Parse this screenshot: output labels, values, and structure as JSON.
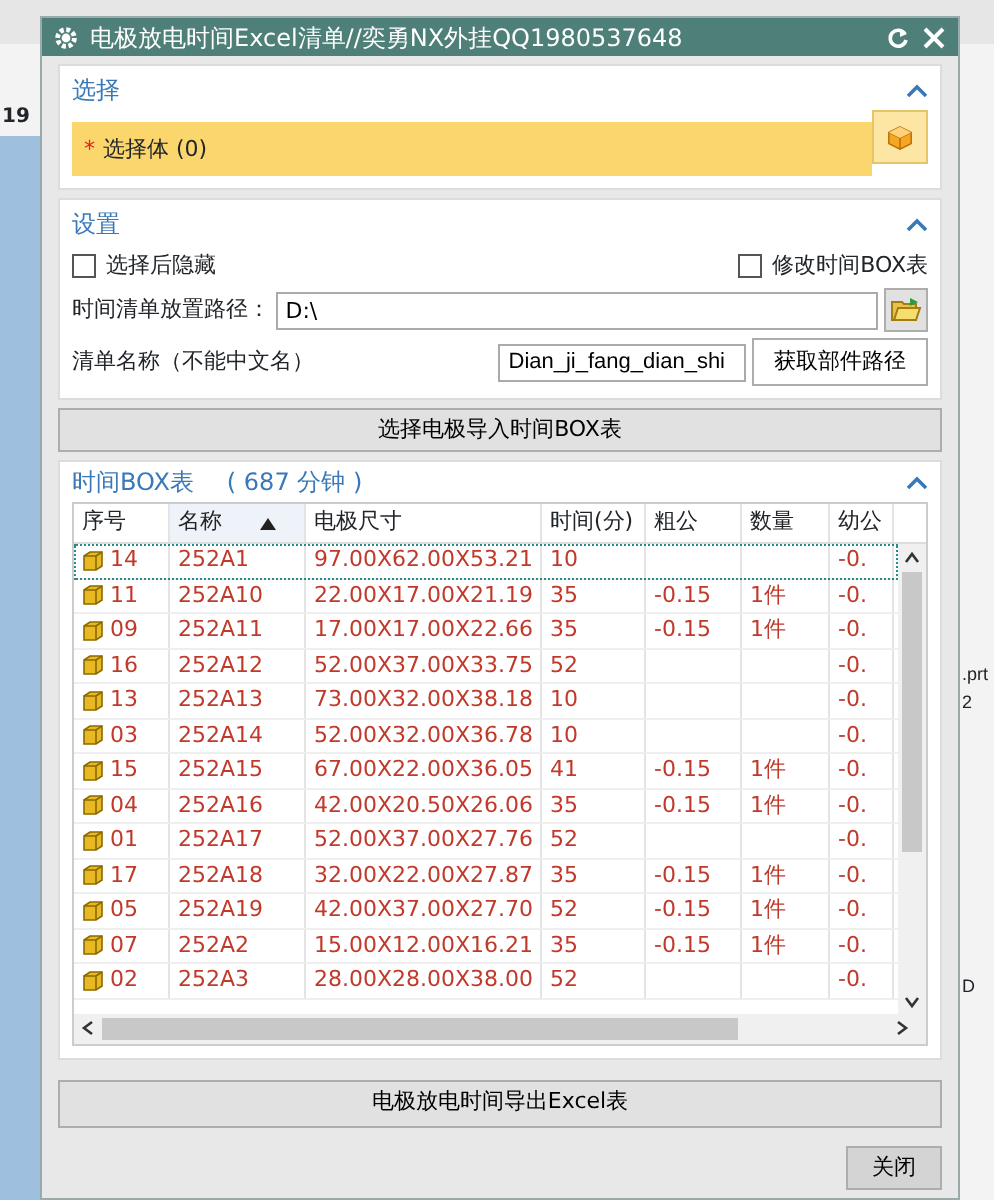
{
  "background": {
    "left_text": "19",
    "right_texts": [
      ".prt",
      "2",
      "D"
    ]
  },
  "window": {
    "title": "电极放电时间Excel清单//奕勇NX外挂QQ1980537648"
  },
  "select_section": {
    "title": "选择",
    "expanded": true,
    "required_mark": "*",
    "label": "选择体 (0)"
  },
  "settings_section": {
    "title": "设置",
    "expanded": true,
    "checkboxes": [
      {
        "label": "选择后隐藏",
        "checked": false
      },
      {
        "label": "修改时间BOX表",
        "checked": false
      }
    ],
    "path_label": "时间清单放置路径：",
    "path_value": "D:\\",
    "name_label": "清单名称（不能中文名）",
    "name_value": "Dian_ji_fang_dian_shi",
    "get_path_button": "获取部件路径"
  },
  "import_button": "选择电极导入时间BOX表",
  "table_section": {
    "title": "时间BOX表",
    "total": "( 687 分钟 )",
    "expanded": true,
    "columns": [
      {
        "label": "序号",
        "sorted": false
      },
      {
        "label": "名称",
        "sorted": true
      },
      {
        "label": "电极尺寸",
        "sorted": false
      },
      {
        "label": "时间(分)",
        "sorted": false
      },
      {
        "label": "粗公",
        "sorted": false
      },
      {
        "label": "数量",
        "sorted": false
      },
      {
        "label": "幼公",
        "sorted": false
      }
    ],
    "rows": [
      {
        "selected": true,
        "cells": [
          "14",
          "252A1",
          "97.00X62.00X53.21",
          "10",
          "",
          "",
          "-0."
        ]
      },
      {
        "selected": false,
        "cells": [
          "11",
          "252A10",
          "22.00X17.00X21.19",
          "35",
          "-0.15",
          "1件",
          "-0."
        ]
      },
      {
        "selected": false,
        "cells": [
          "09",
          "252A11",
          "17.00X17.00X22.66",
          "35",
          "-0.15",
          "1件",
          "-0."
        ]
      },
      {
        "selected": false,
        "cells": [
          "16",
          "252A12",
          "52.00X37.00X33.75",
          "52",
          "",
          "",
          "-0."
        ]
      },
      {
        "selected": false,
        "cells": [
          "13",
          "252A13",
          "73.00X32.00X38.18",
          "10",
          "",
          "",
          "-0."
        ]
      },
      {
        "selected": false,
        "cells": [
          "03",
          "252A14",
          "52.00X32.00X36.78",
          "10",
          "",
          "",
          "-0."
        ]
      },
      {
        "selected": false,
        "cells": [
          "15",
          "252A15",
          "67.00X22.00X36.05",
          "41",
          "-0.15",
          "1件",
          "-0."
        ]
      },
      {
        "selected": false,
        "cells": [
          "04",
          "252A16",
          "42.00X20.50X26.06",
          "35",
          "-0.15",
          "1件",
          "-0."
        ]
      },
      {
        "selected": false,
        "cells": [
          "01",
          "252A17",
          "52.00X37.00X27.76",
          "52",
          "",
          "",
          "-0."
        ]
      },
      {
        "selected": false,
        "cells": [
          "17",
          "252A18",
          "32.00X22.00X27.87",
          "35",
          "-0.15",
          "1件",
          "-0."
        ]
      },
      {
        "selected": false,
        "cells": [
          "05",
          "252A19",
          "42.00X37.00X27.70",
          "52",
          "-0.15",
          "1件",
          "-0."
        ]
      },
      {
        "selected": false,
        "cells": [
          "07",
          "252A2",
          "15.00X12.00X16.21",
          "35",
          "-0.15",
          "1件",
          "-0."
        ]
      },
      {
        "selected": false,
        "cells": [
          "02",
          "252A3",
          "28.00X28.00X38.00",
          "52",
          "",
          "",
          "-0."
        ]
      }
    ]
  },
  "export_button": "电极放电时间导出Excel表",
  "close_button": "关闭"
}
